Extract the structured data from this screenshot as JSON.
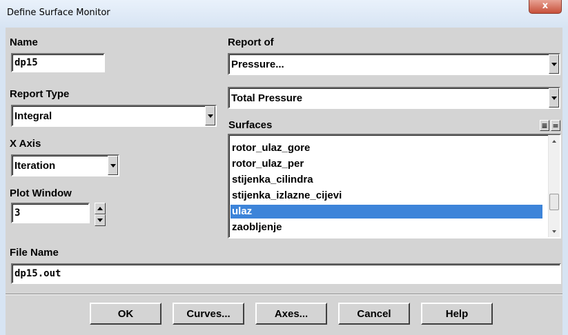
{
  "window": {
    "title": "Define Surface Monitor",
    "close_glyph": "x"
  },
  "name": {
    "label": "Name",
    "value": "dp15"
  },
  "report_of": {
    "label": "Report of",
    "value": "Pressure...",
    "sub_value": "Total Pressure"
  },
  "report_type": {
    "label": "Report Type",
    "value": "Integral"
  },
  "surfaces": {
    "label": "Surfaces",
    "select_all_glyph": "≡",
    "deselect_all_glyph": "=",
    "items": [
      {
        "label": "rotor_ulaz_gore",
        "selected": false
      },
      {
        "label": "rotor_ulaz_per",
        "selected": false
      },
      {
        "label": "stijenka_cilindra",
        "selected": false
      },
      {
        "label": "stijenka_izlazne_cijevi",
        "selected": false
      },
      {
        "label": "ulaz",
        "selected": true
      },
      {
        "label": "zaobljenje",
        "selected": false
      }
    ]
  },
  "x_axis": {
    "label": "X Axis",
    "value": "Iteration"
  },
  "plot_window": {
    "label": "Plot Window",
    "value": "3"
  },
  "file_name": {
    "label": "File Name",
    "value": "dp15.out"
  },
  "buttons": {
    "ok": "OK",
    "curves": "Curves...",
    "axes": "Axes...",
    "cancel": "Cancel",
    "help": "Help"
  },
  "colors": {
    "selection": "#3d84d9",
    "dialog_bg": "#d4d4d4",
    "close_button": "#c7503a"
  }
}
